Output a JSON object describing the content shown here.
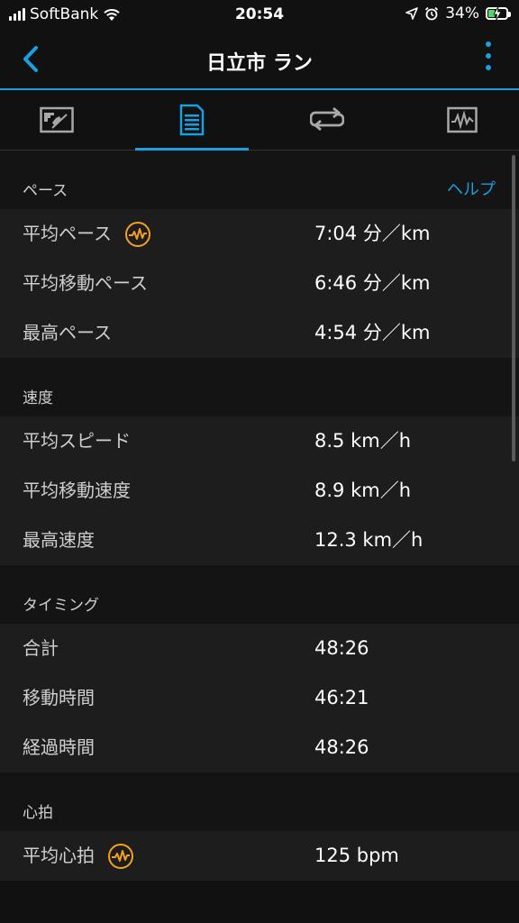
{
  "status_bar": {
    "carrier": "SoftBank",
    "time": "20:54",
    "battery": "34%"
  },
  "header": {
    "title": "日立市 ラン"
  },
  "tabs": [
    {
      "name": "map-tab",
      "icon": "map-icon"
    },
    {
      "name": "stats-tab",
      "icon": "document-icon"
    },
    {
      "name": "laps-tab",
      "icon": "laps-icon"
    },
    {
      "name": "charts-tab",
      "icon": "chart-icon"
    }
  ],
  "colors": {
    "accent": "#1a9fe0",
    "hr_badge": "#f2a024",
    "background": "#111111",
    "row_background": "#1d1d1d"
  },
  "sections": {
    "pace": {
      "title": "ペース",
      "help": "ヘルプ",
      "rows": [
        {
          "label": "平均ペース",
          "value": "7:04 分／km"
        },
        {
          "label": "平均移動ペース",
          "value": "6:46 分／km"
        },
        {
          "label": "最高ペース",
          "value": "4:54 分／km"
        }
      ]
    },
    "speed": {
      "title": "速度",
      "rows": [
        {
          "label": "平均スピード",
          "value": "8.5 km／h"
        },
        {
          "label": "平均移動速度",
          "value": "8.9 km／h"
        },
        {
          "label": "最高速度",
          "value": "12.3 km／h"
        }
      ]
    },
    "timing": {
      "title": "タイミング",
      "rows": [
        {
          "label": "合計",
          "value": "48:26"
        },
        {
          "label": "移動時間",
          "value": "46:21"
        },
        {
          "label": "経過時間",
          "value": "48:26"
        }
      ]
    },
    "heart": {
      "title": "心拍",
      "rows": [
        {
          "label": "平均心拍",
          "value": "125 bpm"
        }
      ]
    }
  }
}
